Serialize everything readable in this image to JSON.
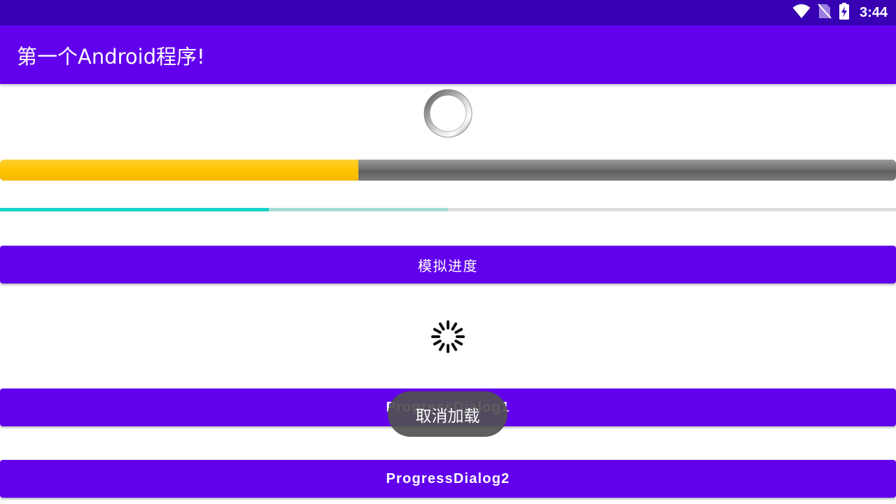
{
  "status_bar": {
    "time": "3:44",
    "icons": [
      "wifi-icon",
      "no-sim-icon",
      "battery-charging-icon"
    ],
    "color": "#3700b3"
  },
  "app_bar": {
    "title": "第一个Android程序!",
    "color": "#6200ee"
  },
  "progress_bar_horizontal": {
    "progress": 0.4,
    "fill_color": "#ffc400"
  },
  "progress_bar_thin": {
    "progress": 0.3,
    "secondary_progress": 0.5,
    "color": "#17d4cb"
  },
  "buttons": {
    "simulate": "模拟进度",
    "dialog1": "ProgressDialog1",
    "dialog2": "ProgressDialog2"
  },
  "toast": {
    "text": "取消加载"
  }
}
